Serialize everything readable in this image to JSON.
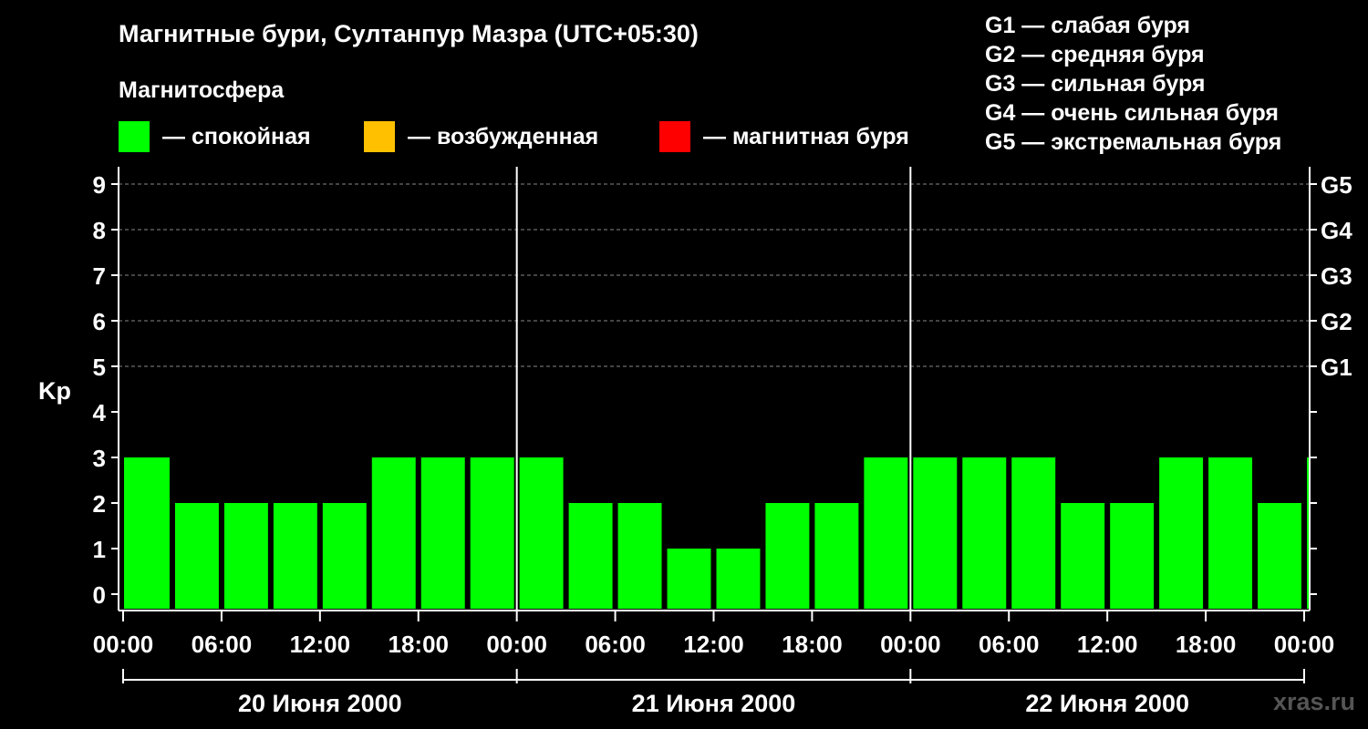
{
  "title": "Магнитные бури, Султанпур Мазра (UTC+05:30)",
  "magnetosphere": {
    "title": "Магнитосфера",
    "legend": [
      {
        "color": "#00ff00",
        "label": "— спокойная"
      },
      {
        "color": "#ffc000",
        "label": "— возбужденная"
      },
      {
        "color": "#ff0000",
        "label": "— магнитная буря"
      }
    ]
  },
  "g_scale": [
    "G1 — слабая буря",
    "G2 — средняя буря",
    "G3 — сильная буря",
    "G4 — очень сильная буря",
    "G5 — экстремальная буря"
  ],
  "watermark": "xras.ru",
  "chart_data": {
    "type": "bar",
    "ylabel": "Kp",
    "ylim": [
      0,
      9
    ],
    "yticks": [
      0,
      1,
      2,
      3,
      4,
      5,
      6,
      7,
      8,
      9
    ],
    "right_axis_labels": [
      {
        "kp": 5,
        "label": "G1"
      },
      {
        "kp": 6,
        "label": "G2"
      },
      {
        "kp": 7,
        "label": "G3"
      },
      {
        "kp": 8,
        "label": "G4"
      },
      {
        "kp": 9,
        "label": "G5"
      }
    ],
    "x_tick_labels": [
      "00:00",
      "06:00",
      "12:00",
      "18:00",
      "00:00",
      "06:00",
      "12:00",
      "18:00",
      "00:00",
      "06:00",
      "12:00",
      "18:00",
      "00:00"
    ],
    "days": [
      "20 Июня 2000",
      "21 Июня 2000",
      "22 Июня 2000"
    ],
    "interval_hours": 3,
    "values": [
      3,
      2,
      2,
      2,
      2,
      3,
      3,
      3,
      3,
      2,
      2,
      1,
      1,
      2,
      2,
      3,
      3,
      3,
      3,
      2,
      2,
      3,
      3,
      2,
      3
    ],
    "bar_color": "#00ff00",
    "grid": "dashed horizontal"
  }
}
